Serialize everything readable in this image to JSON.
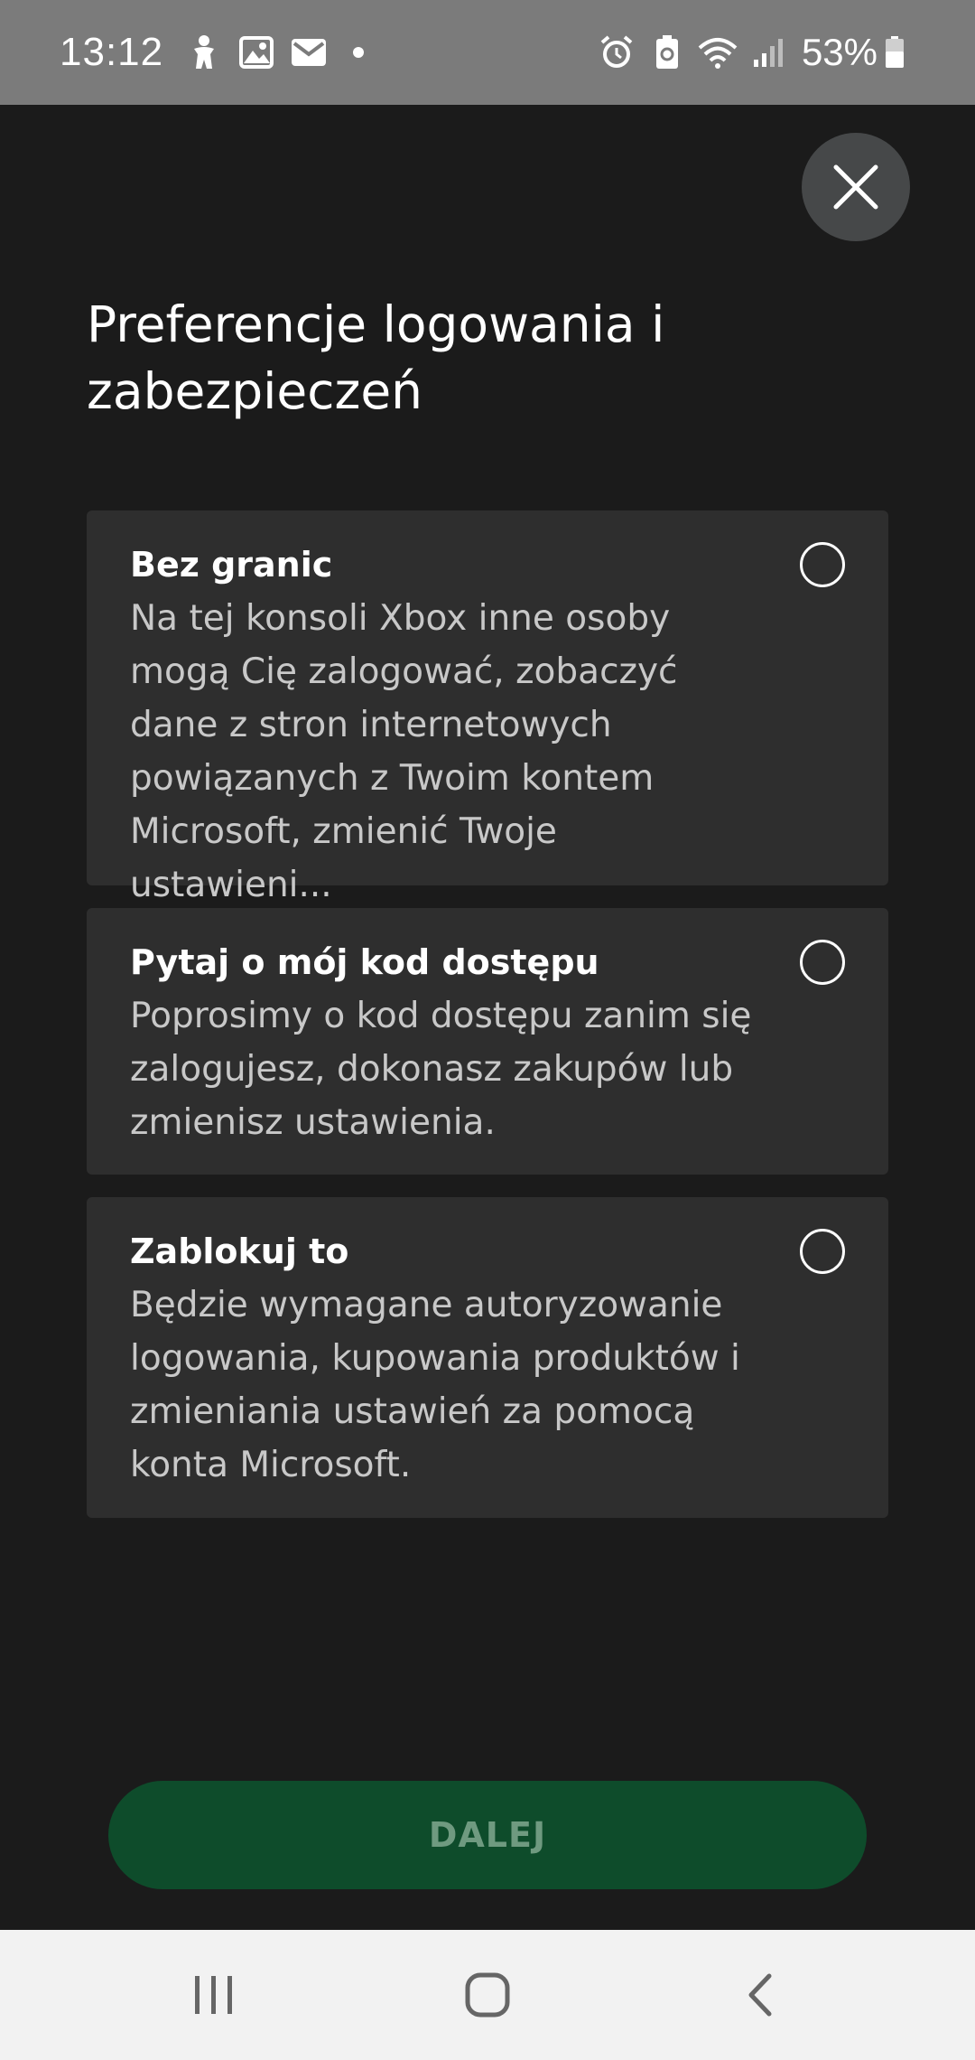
{
  "status_bar": {
    "time": "13:12",
    "battery_percent": "53%",
    "left_icons": [
      "accessibility-icon",
      "gallery-icon",
      "mail-icon",
      "notification-dot"
    ],
    "right_icons": [
      "alarm-icon",
      "battery-saver-icon",
      "wifi-icon",
      "signal-icon",
      "battery-icon"
    ]
  },
  "page": {
    "title": "Preferencje logowania i zabezpieczeń"
  },
  "options": [
    {
      "title": "Bez granic",
      "description": "Na tej konsoli Xbox inne osoby mogą Cię zalogować, zobaczyć dane z stron internetowych powiązanych z Twoim kontem Microsoft, zmienić Twoje ustawieni...",
      "selected": false
    },
    {
      "title": "Pytaj o mój kod dostępu",
      "description": "Poprosimy o kod dostępu zanim się zalogujesz, dokonasz zakupów lub zmienisz ustawienia.",
      "selected": false
    },
    {
      "title": "Zablokuj to",
      "description": "Będzie wymagane autoryzowanie logowania, kupowania produktów i zmieniania ustawień za pomocą konta Microsoft.",
      "selected": false
    }
  ],
  "actions": {
    "next_label": "DALEJ"
  },
  "colors": {
    "background": "#1b1b1b",
    "card": "#2e2e2e",
    "accent_button": "#0e4c2b",
    "accent_button_text": "#6f9a80",
    "status_bar": "#7b7b7b",
    "nav_bar": "#f2f2f2"
  }
}
